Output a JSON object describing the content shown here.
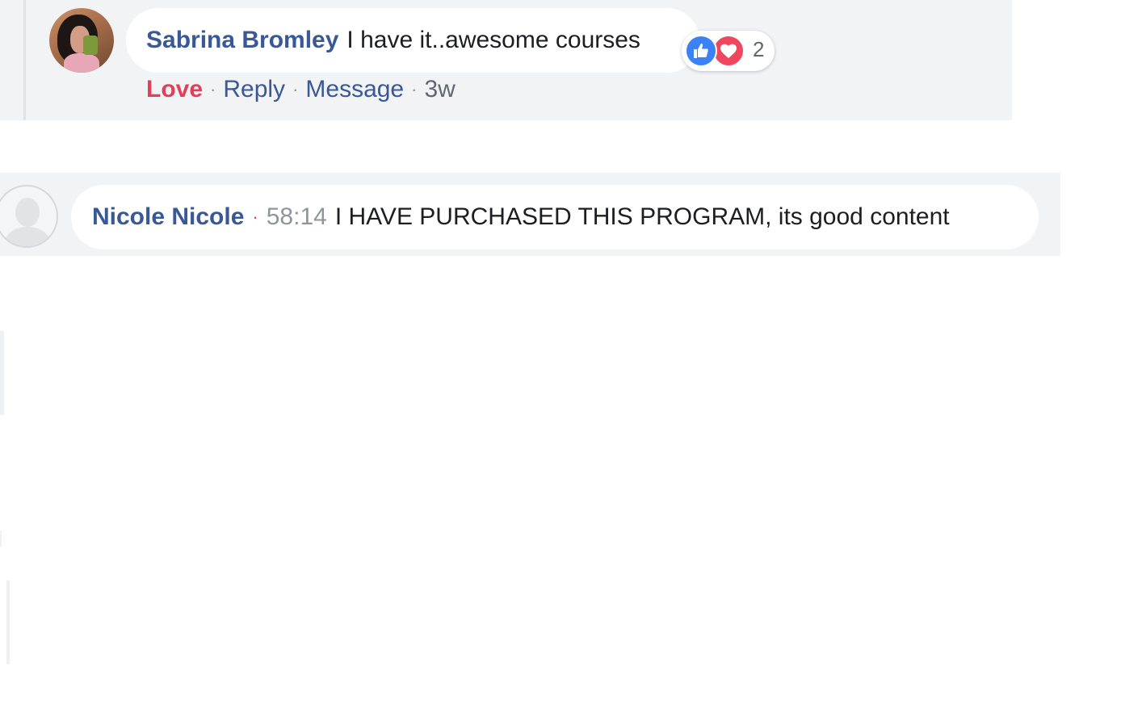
{
  "comment1": {
    "author": "Sabrina Bromley",
    "text": "I have it..awesome courses",
    "reactions": {
      "types": [
        "like-icon",
        "love-icon"
      ],
      "count": "2"
    },
    "actions": {
      "love": "Love",
      "reply": "Reply",
      "message": "Message",
      "time": "3w"
    }
  },
  "comment2": {
    "author": "Nicole Nicole",
    "timestamp": "58:14",
    "text": "I HAVE PURCHASED THIS PROGRAM, its good content"
  },
  "separator": "·",
  "colors": {
    "author": "#385898",
    "love": "#e0405a",
    "like_blue": "#3b82f6",
    "love_red": "#f0475f",
    "block_bg": "#f2f3f5"
  }
}
